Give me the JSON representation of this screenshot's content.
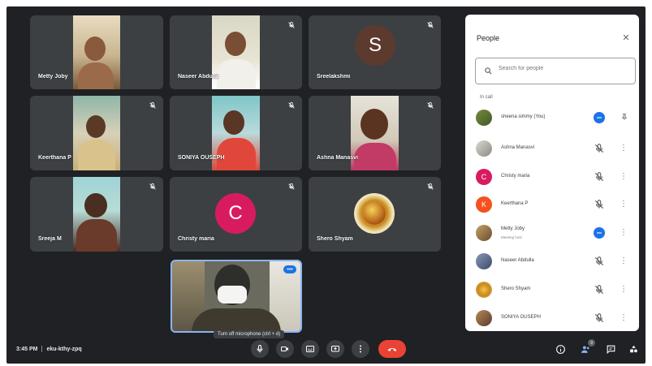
{
  "tiles": [
    {
      "name": "Metty Joby",
      "initial": ""
    },
    {
      "name": "Naseer Abdulla",
      "initial": ""
    },
    {
      "name": "Sreelakshmi",
      "initial": "S"
    },
    {
      "name": "Keerthana P",
      "initial": ""
    },
    {
      "name": "SONIYA OUSEPH",
      "initial": ""
    },
    {
      "name": "Ashna Manasvi",
      "initial": ""
    },
    {
      "name": "Sreeja M",
      "initial": ""
    },
    {
      "name": "Christy maria",
      "initial": "C"
    },
    {
      "name": "Shero Shyam",
      "initial": ""
    }
  ],
  "self_tooltip": "Turn off microphone (ctrl + d)",
  "bottom_bar": {
    "time": "3:45 PM",
    "meeting_code": "eku-kthy-zpq",
    "participants_count": "9"
  },
  "colors": {
    "background": "#202124",
    "tile": "#3c4043",
    "end_call": "#ea4335",
    "accent": "#1a73e8",
    "avatar_s": "#5d3a2e",
    "avatar_c": "#d81b60",
    "avatar_k": "#f4511e"
  },
  "people_panel": {
    "title": "People",
    "search_placeholder": "Search for people",
    "section_label": "In call",
    "participants": [
      {
        "name": "sheena simmy (You)",
        "subtitle": "",
        "initial": "",
        "status": "speaking",
        "action": "pin"
      },
      {
        "name": "Ashna Manasvi",
        "subtitle": "",
        "initial": "",
        "status": "muted",
        "action": "more"
      },
      {
        "name": "Christy maria",
        "subtitle": "",
        "initial": "C",
        "status": "muted",
        "action": "more"
      },
      {
        "name": "Keerthana P",
        "subtitle": "",
        "initial": "K",
        "status": "muted",
        "action": "more"
      },
      {
        "name": "Metty Joby",
        "subtitle": "Meeting host",
        "initial": "",
        "status": "speaking",
        "action": "more"
      },
      {
        "name": "Naseer Abdulla",
        "subtitle": "",
        "initial": "",
        "status": "muted",
        "action": "more"
      },
      {
        "name": "Shero Shyam",
        "subtitle": "",
        "initial": "",
        "status": "muted",
        "action": "more"
      },
      {
        "name": "SONIYA OUSEPH",
        "subtitle": "",
        "initial": "",
        "status": "muted",
        "action": "more"
      }
    ]
  },
  "icons": [
    "mic-off-icon",
    "mic-icon",
    "camera-icon",
    "captions-icon",
    "present-icon",
    "more-vert-icon",
    "end-call-icon",
    "info-icon",
    "people-icon",
    "chat-icon",
    "activities-icon",
    "search-icon",
    "close-icon",
    "pin-icon"
  ]
}
